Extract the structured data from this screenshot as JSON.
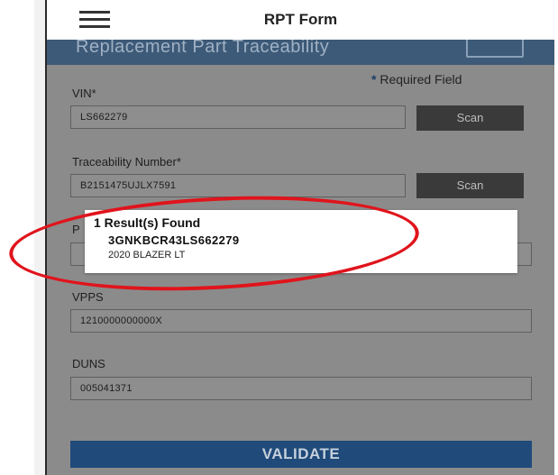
{
  "header": {
    "title": "RPT Form",
    "menu_icon": "hamburger-menu-icon"
  },
  "banner": {
    "title": "Replacement Part Traceability"
  },
  "form": {
    "required_note": "Required Field",
    "required_marker": "*",
    "vin": {
      "label": "VIN*",
      "value": "LS662279",
      "scan_label": "Scan"
    },
    "traceability": {
      "label": "Traceability Number*",
      "value": "B2151475UJLX7591",
      "scan_label": "Scan"
    },
    "part": {
      "label": "P"
    },
    "vpps": {
      "label": "VPPS",
      "value": "1210000000000X"
    },
    "duns": {
      "label": "DUNS",
      "value": "005041371"
    },
    "validate_label": "VALIDATE"
  },
  "popup": {
    "title": "1 Result(s) Found",
    "result_vin": "3GNKBCR43LS662279",
    "result_model": "2020 BLAZER LT"
  },
  "colors": {
    "banner": "#3d5a78",
    "screen_bg": "#8b8b8b",
    "validate": "#1f4a7a",
    "highlight": "#e0141c"
  }
}
